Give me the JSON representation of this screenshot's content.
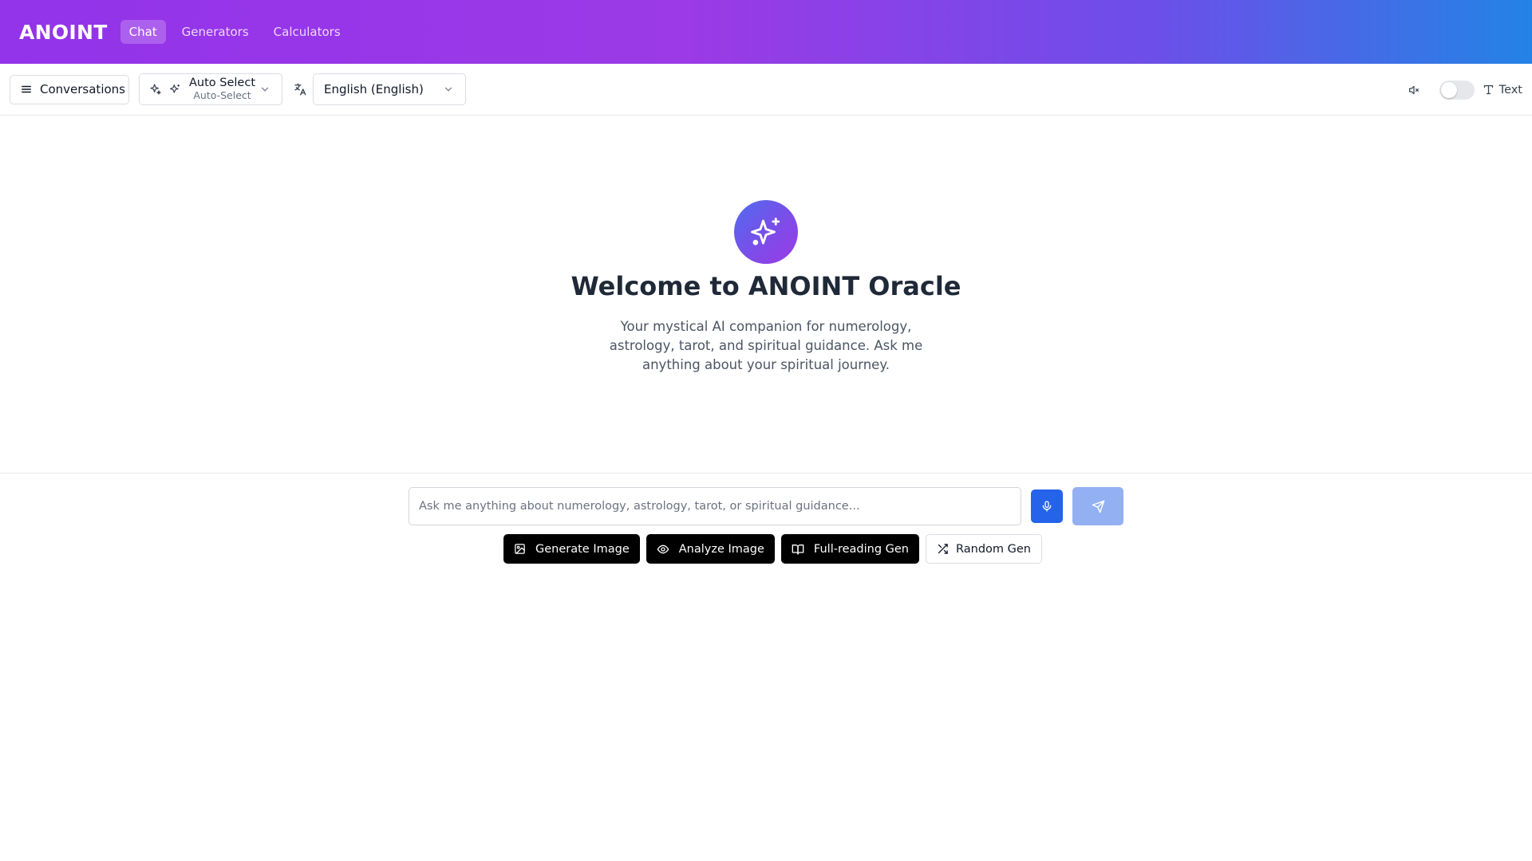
{
  "header": {
    "brand": "ANOINT",
    "nav": [
      {
        "label": "Chat",
        "active": true
      },
      {
        "label": "Generators",
        "active": false
      },
      {
        "label": "Calculators",
        "active": false
      }
    ],
    "gradient_colors": [
      "#9333ea",
      "#2383e6"
    ]
  },
  "toolbar": {
    "conversations_label": "Conversations",
    "model": {
      "label": "Auto Select",
      "sublabel": "Auto-Select"
    },
    "language": {
      "selected": "English (English)"
    },
    "text_mode_label": "Text",
    "voice_toggle_on": false
  },
  "hero": {
    "title": "Welcome to ANOINT Oracle",
    "description": "Your mystical AI companion for numerology, astrology, tarot, and spiritual guidance. Ask me anything about your spiritual journey.",
    "icon": "sparkles-icon"
  },
  "composer": {
    "placeholder": "Ask me anything about numerology, astrology, tarot, or spiritual guidance...",
    "value": "",
    "quick_actions": [
      {
        "label": "Generate Image",
        "icon": "image-icon",
        "style": "dark"
      },
      {
        "label": "Analyze Image",
        "icon": "eye-icon",
        "style": "dark"
      },
      {
        "label": "Full-reading Gen",
        "icon": "book-open-icon",
        "style": "dark"
      },
      {
        "label": "Random Gen",
        "icon": "shuffle-icon",
        "style": "light"
      }
    ]
  },
  "colors": {
    "accent": "#2563eb",
    "send_disabled": "#93b0f3",
    "purple": "#9333ea"
  }
}
